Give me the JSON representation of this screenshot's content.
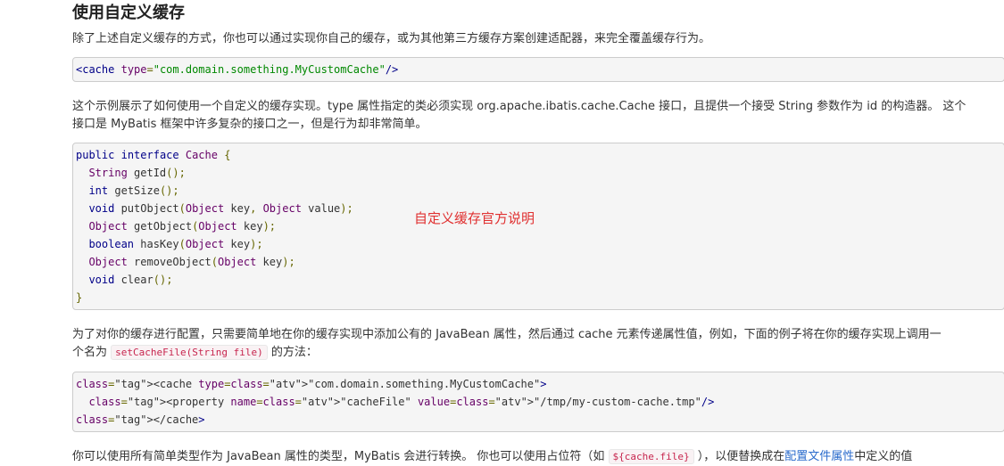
{
  "section": {
    "title": "使用自定义缓存"
  },
  "para1": "除了上述自定义缓存的方式，你也可以通过实现你自己的缓存，或为其他第三方缓存方案创建适配器，来完全覆盖缓存行为。",
  "code1": {
    "tag_open": "<cache",
    "attr": "type",
    "value": "\"com.domain.something.MyCustomCache\"",
    "tag_close": "/>"
  },
  "para2": {
    "line1": "这个示例展示了如何使用一个自定义的缓存实现。type 属性指定的类必须实现 org.apache.ibatis.cache.Cache 接口，且提供一个接受 String 参数作为 id 的构造器。 这个",
    "line2": "接口是 MyBatis 框架中许多复杂的接口之一，但是行为却非常简单。"
  },
  "code2": {
    "lines": [
      "public interface Cache {",
      "  String getId();",
      "  int getSize();",
      "  void putObject(Object key, Object value);",
      "  Object getObject(Object key);",
      "  boolean hasKey(Object key);",
      "  Object removeObject(Object key);",
      "  void clear();",
      "}"
    ]
  },
  "annotation": "自定义缓存官方说明",
  "para3": {
    "line1": "为了对你的缓存进行配置，只需要简单地在你的缓存实现中添加公有的 JavaBean 属性，然后通过 cache 元素传递属性值，例如，下面的例子将在你的缓存实现上调用一",
    "line2_prefix": "个名为",
    "inline_code": "setCacheFile(String file)",
    "line2_suffix": "的方法："
  },
  "code3": {
    "lines": [
      "<cache type=\"com.domain.something.MyCustomCache\">",
      "  <property name=\"cacheFile\" value=\"/tmp/my-custom-cache.tmp\"/>",
      "</cache>"
    ]
  },
  "para4": {
    "prefix": "你可以使用所有简单类型作为 JavaBean 属性的类型，MyBatis 会进行转换。 你也可以使用占位符（如",
    "inline_code": "${cache.file}",
    "middle": "），以便替换成在",
    "link": "配置文件属性",
    "suffix": "中定义的值"
  },
  "colors": {
    "code_bg": "#f5f5f5",
    "keyword": "#000088",
    "type": "#660066",
    "string": "#008800",
    "annotation": "#e03030",
    "link": "#2a6bcc"
  }
}
